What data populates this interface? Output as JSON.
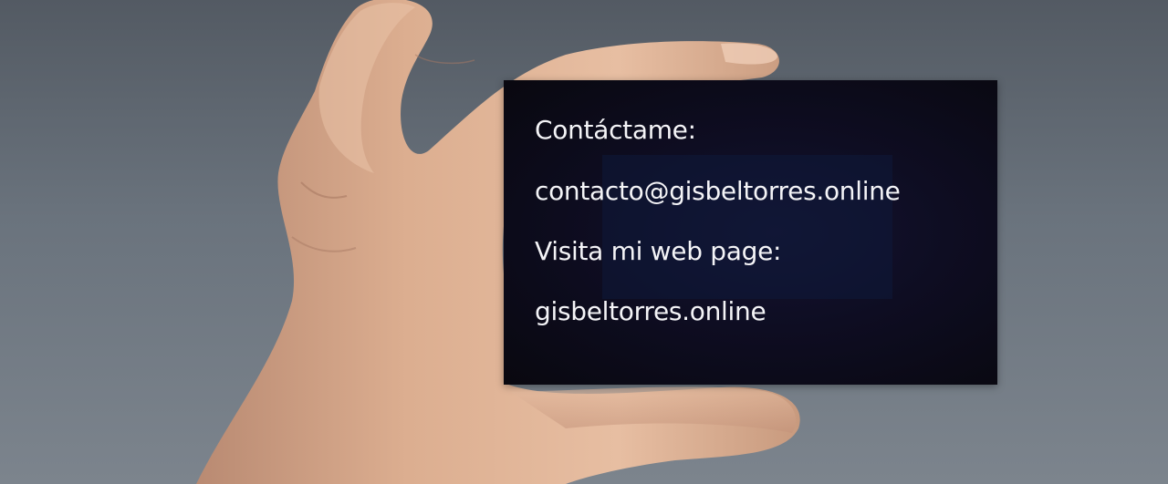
{
  "card": {
    "line1": "Contáctame:",
    "line2": "contacto@gisbeltorres.online",
    "line3": "Visita mi web page:",
    "line4": "gisbeltorres.online"
  },
  "colors": {
    "background": "#6a737d",
    "card": "#0d0c1e",
    "text": "#f4f4f7",
    "skin": "#d9a88a"
  }
}
